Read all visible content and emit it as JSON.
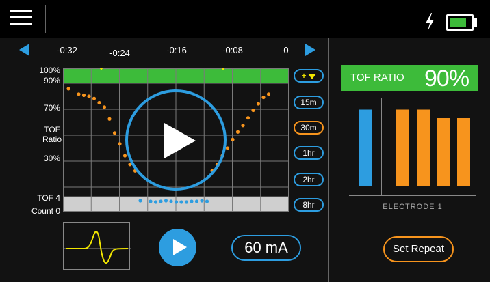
{
  "header": {
    "menu_icon": "hamburger-menu-icon",
    "charging_icon": "lightning-bolt-icon",
    "battery_icon": "battery-icon",
    "battery_level": 0.75
  },
  "timeline": {
    "ticks": [
      "-0:32",
      "-0:24",
      "-0:16",
      "-0:08",
      "0"
    ],
    "prev_icon": "arrow-left-icon",
    "next_icon": "arrow-right-icon"
  },
  "y_axis": {
    "p100": "100%",
    "p90": "90%",
    "p70": "70%",
    "tof_label_1": "TOF",
    "tof_label_2": "Ratio",
    "p30": "30%",
    "tof4": "TOF 4",
    "count0": "Count 0"
  },
  "time_ranges": {
    "expand": "+",
    "items": [
      "15m",
      "30m",
      "1hr",
      "2hr",
      "8hr"
    ],
    "active": "30m"
  },
  "chart_data": {
    "type": "scatter",
    "series": [
      {
        "x": [
          0,
          6,
          9,
          12,
          15,
          18,
          21,
          24,
          27,
          30,
          33,
          36,
          39,
          84,
          87,
          90,
          93,
          96,
          99,
          102,
          105,
          108,
          111,
          114,
          117
        ],
        "values": [
          95,
          90,
          89,
          88,
          86,
          82,
          78,
          67,
          54,
          44,
          33,
          25,
          19,
          19,
          25,
          33,
          40,
          48,
          55,
          61,
          68,
          75,
          81,
          87,
          90
        ],
        "color": "#f7941d"
      },
      {
        "x": [
          42,
          48,
          51,
          54,
          57,
          60,
          63,
          66,
          69,
          72,
          75,
          78,
          81
        ],
        "values": [
          2,
          1,
          0,
          1,
          2,
          1,
          0,
          0,
          0,
          1,
          1,
          2,
          1
        ],
        "color": "#2d9de0"
      }
    ],
    "colors": {
      "green_band": "#3dbb3a",
      "count_band": "#cfcfcf",
      "markers": "#f2e600"
    }
  },
  "controls": {
    "play_overlay_icon": "play-icon",
    "waveform_icon": "waveform-icon",
    "play_icon": "play-icon",
    "current": "60 mA"
  },
  "right_panel": {
    "tof_label": "TOF RATIO",
    "tof_value": "90%",
    "electrode_label": "ELECTRODE 1",
    "bars": [
      {
        "value": 90,
        "color": "#2d9de0"
      },
      {
        "value": 90,
        "color": "#f7941d"
      },
      {
        "value": 90,
        "color": "#f7941d"
      },
      {
        "value": 80,
        "color": "#f7941d"
      },
      {
        "value": 80,
        "color": "#f7941d"
      }
    ],
    "repeat_label": "Set Repeat"
  }
}
